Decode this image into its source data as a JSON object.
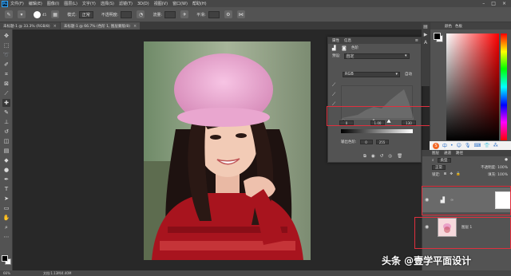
{
  "menubar": {
    "logo": "Ps",
    "items": [
      "文件(F)",
      "编辑(E)",
      "图像(I)",
      "图层(L)",
      "文字(Y)",
      "选择(S)",
      "滤镜(T)",
      "3D(D)",
      "视图(V)",
      "窗口(W)",
      "帮助(H)"
    ]
  },
  "optionsbar": {
    "brush_size": "45",
    "mode_label": "模式:",
    "mode_value": "正常",
    "opacity_label": "不透明度:",
    "flow_label": "流量:",
    "smoothing_label": "平滑:"
  },
  "tabs": [
    {
      "label": "未标题-1 @ 33.3% (RGB/8)"
    },
    {
      "label": "未标题-1 @ 66.7% (色阶 1, 图层蒙版/8)"
    }
  ],
  "statusbar": {
    "zoom": "66%",
    "doc": "文档:1.13M/4.40M"
  },
  "properties": {
    "tab_props": "属性",
    "tab_info": "信息",
    "title": "色阶",
    "preset_label": "预设:",
    "preset_value": "自定",
    "channel_value": "RGB",
    "auto_label": "自动",
    "input_black": "0",
    "input_gamma": "1.00",
    "input_white": "130",
    "output_label": "输出色阶:",
    "output_black": "0",
    "output_white": "255"
  },
  "color_panel": {
    "tab_color": "颜色",
    "tab_swatches": "色板"
  },
  "layers": {
    "tab_layers": "图层",
    "tab_channels": "通道",
    "tab_paths": "路径",
    "kind_label": "类型",
    "blend_mode": "正常",
    "opacity_label": "不透明度:",
    "opacity_value": "100%",
    "lock_label": "锁定:",
    "fill_label": "填充:",
    "fill_value": "100%",
    "bottom_layer_name": "图层 1"
  },
  "watermark": "头条 @壹学平面设计"
}
